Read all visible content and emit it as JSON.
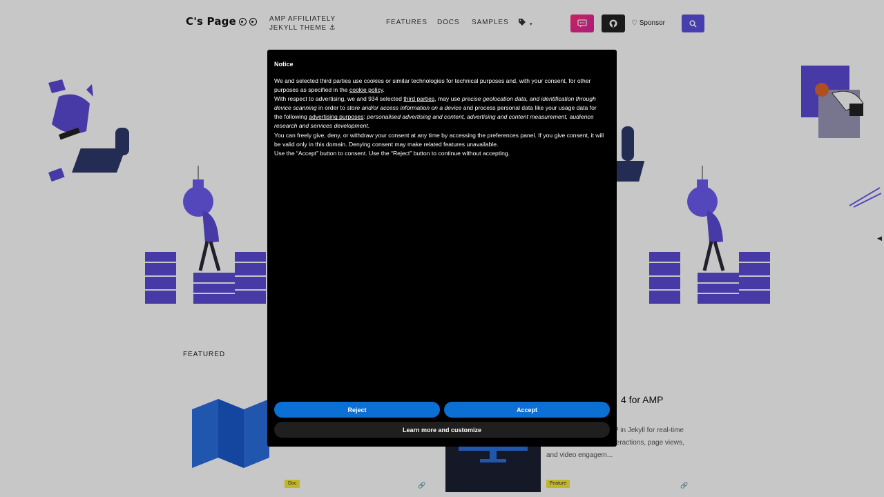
{
  "header": {
    "logo_text": "C's Page",
    "tagline_line1": "AMP AFFILIATELY",
    "tagline_line2": "JEKYLL THEME ⚓",
    "nav": [
      "FEATURES",
      "DOCS",
      "SAMPLES"
    ],
    "tags_icon": "tags-icon",
    "sponsor_label": "Sponsor",
    "colors": {
      "chat_button": "#e0287f",
      "github_button": "#222222",
      "search_button": "#5a4fe0"
    }
  },
  "page": {
    "featured_label": "FEATURED",
    "card_title_fragment": "4 for AMP",
    "card_desc_lines": [
      "P in Jekyll for real-time",
      "teractions, page views,",
      "and video engagem..."
    ],
    "badge_doc": "Doc",
    "badge_feature": "Feature"
  },
  "modal": {
    "title": "Notice",
    "p1_a": "We and selected third parties use cookies or similar technologies for technical purposes and, with your consent, for other purposes as specified in the ",
    "p1_link": "cookie policy",
    "p1_b": ".",
    "p2_a": "With respect to advertising, we and 934 selected ",
    "p2_link1": "third parties",
    "p2_b": ", may use ",
    "p2_em1": "precise geolocation data, and identification through device scanning",
    "p2_c": " in order to ",
    "p2_em2": "store and/or access information on a device",
    "p2_d": " and process personal data like your usage data for the following ",
    "p2_link2": "advertising purposes",
    "p2_e": ": ",
    "p2_em3": "personalised advertising and content, advertising and content measurement, audience research and services development",
    "p2_f": ".",
    "p3": "You can freely give, deny, or withdraw your consent at any time by accessing the preferences panel. If you give consent, it will be valid only in this domain. Denying consent may make related features unavailable.",
    "p4": "Use the “Accept” button to consent. Use the “Reject” button to continue without accepting.",
    "reject_label": "Reject",
    "accept_label": "Accept",
    "learn_label": "Learn more and customize",
    "button_color": "#0b6fd3"
  }
}
